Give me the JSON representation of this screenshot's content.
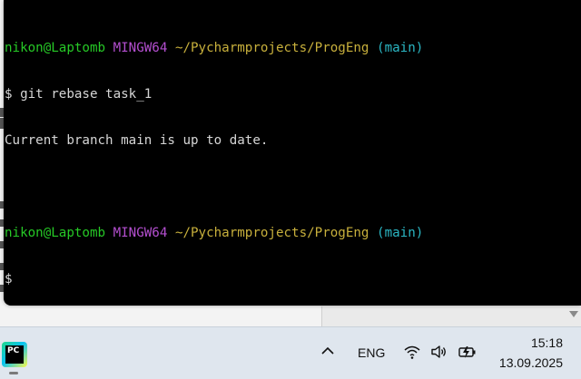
{
  "terminal": {
    "lines": [
      {
        "user": "nikon@Laptomb",
        "host": "MINGW64",
        "path": "~/Pycharmprojects/ProgEng",
        "branch": "(main)"
      },
      {
        "text": "$ git rebase task_1"
      },
      {
        "text": "Current branch main is up to date."
      },
      {
        "text": ""
      },
      {
        "user": "nikon@Laptomb",
        "host": "MINGW64",
        "path": "~/Pycharmprojects/ProgEng",
        "branch": "(main)"
      },
      {
        "text": "$"
      }
    ],
    "colors": {
      "user": "#26c926",
      "host": "#b44fd0",
      "path": "#c8b03c",
      "branch": "#2bb7c4",
      "text": "#d6d6d6",
      "background": "#000000"
    }
  },
  "taskbar": {
    "app_icon": {
      "name": "pycharm-icon",
      "label": "PC"
    },
    "tray": {
      "chevron": "chevron-up-icon",
      "language": "ENG",
      "wifi": "wifi-icon",
      "volume": "volume-icon",
      "battery": "battery-charging-icon"
    },
    "clock": {
      "time": "15:18",
      "date": "13.09.2025"
    }
  }
}
